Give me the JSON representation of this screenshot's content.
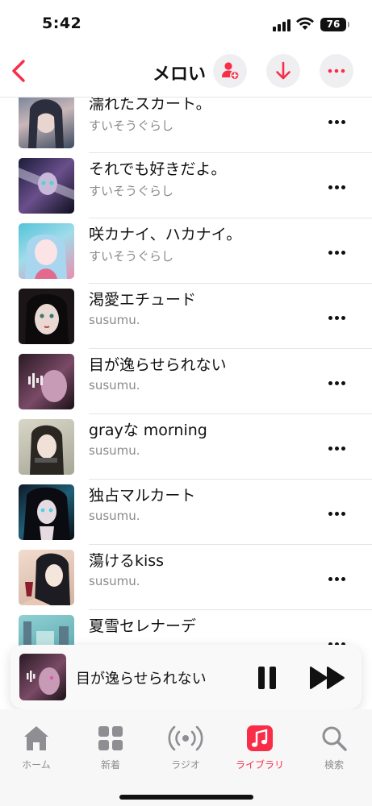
{
  "status_bar": {
    "time": "5:42",
    "battery": "76"
  },
  "nav": {
    "title": "メロい"
  },
  "songs": [
    {
      "title": "濡れたスカート。",
      "artist": "すいそうぐらし"
    },
    {
      "title": "それでも好きだよ。",
      "artist": "すいそうぐらし"
    },
    {
      "title": "咲カナイ、ハカナイ。",
      "artist": "すいそうぐらし"
    },
    {
      "title": "渇愛エチュード",
      "artist": "susumu."
    },
    {
      "title": "目が逸らせられない",
      "artist": "susumu."
    },
    {
      "title": "grayな morning",
      "artist": "susumu."
    },
    {
      "title": "独占マルカート",
      "artist": "susumu."
    },
    {
      "title": "蕩けるkiss",
      "artist": "susumu."
    },
    {
      "title": "夏雪セレナーデ",
      "artist": ""
    }
  ],
  "now_playing": {
    "title": "目が逸らせられない"
  },
  "tabs": [
    {
      "label": "ホーム",
      "icon": "house-icon"
    },
    {
      "label": "新着",
      "icon": "grid-icon"
    },
    {
      "label": "ラジオ",
      "icon": "radio-waves-icon"
    },
    {
      "label": "ライブラリ",
      "icon": "music-library-icon"
    },
    {
      "label": "検索",
      "icon": "magnifier-icon"
    }
  ],
  "colors": {
    "accent": "#fa2d48",
    "secondary_text": "#8a8a8e",
    "tab_inactive": "#8e8e93"
  }
}
